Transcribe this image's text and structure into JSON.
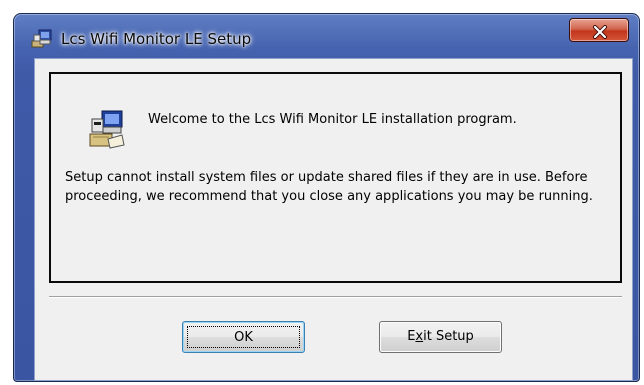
{
  "window": {
    "title": "Lcs Wifi Monitor LE Setup",
    "icon": "installer-computer-icon",
    "close_icon": "close-x-icon"
  },
  "message": {
    "welcome": "Welcome to the Lcs Wifi Monitor LE installation program.",
    "body": "Setup cannot install system files or update shared files if they are in use. Before proceeding, we recommend that you close any applications you may be running."
  },
  "buttons": {
    "ok_label": "OK",
    "exit_prefix": "E",
    "exit_mnemonic": "x",
    "exit_suffix": "it Setup"
  },
  "colors": {
    "title_bar": "#4663b0",
    "close_button": "#c2361d",
    "client_bg": "#f0f0f0"
  }
}
